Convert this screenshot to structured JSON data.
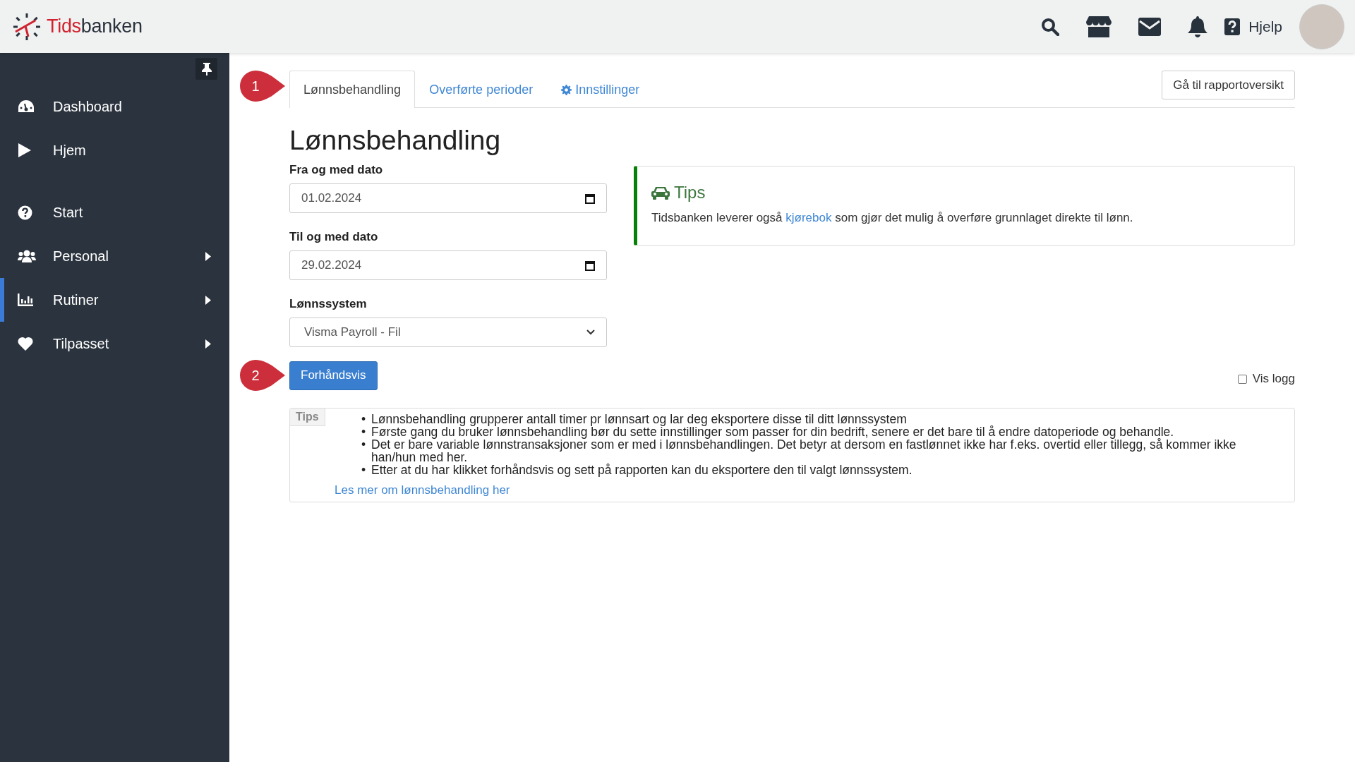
{
  "header": {
    "logo": {
      "part_1": "Tids",
      "part_2": "banken"
    },
    "help_label": "Hjelp"
  },
  "sidebar": {
    "sections": [
      [
        {
          "label": "Dashboard",
          "selected": false,
          "has_submenu": false
        },
        {
          "label": "Hjem",
          "selected": false,
          "has_submenu": false
        }
      ],
      [
        {
          "label": "Start",
          "selected": false,
          "has_submenu": false
        },
        {
          "label": "Personal",
          "selected": false,
          "has_submenu": true
        },
        {
          "label": "Rutiner",
          "selected": true,
          "has_submenu": true
        },
        {
          "label": "Tilpasset",
          "selected": false,
          "has_submenu": true
        }
      ]
    ]
  },
  "callouts": [
    {
      "number": "1"
    },
    {
      "number": "2"
    }
  ],
  "tabs": [
    {
      "label": "Lønnsbehandling",
      "selected": true,
      "has_icon": false
    },
    {
      "label": "Overførte perioder",
      "selected": false,
      "has_icon": false
    },
    {
      "label": "Innstillinger",
      "selected": false,
      "has_icon": true
    }
  ],
  "report_button": "Gå til rapportoversikt",
  "page_title": "Lønnsbehandling",
  "form": {
    "from_date": {
      "label": "Fra og med dato",
      "value": "01.02.2024"
    },
    "to_date": {
      "label": "Til og med dato",
      "value": "29.02.2024"
    },
    "payroll_system": {
      "label": "Lønnssystem",
      "value": "Visma Payroll - Fil"
    }
  },
  "tips_card": {
    "title": "Tips",
    "text_before": "Tidsbanken leverer også",
    "link": "kjørebok",
    "text_after": "som gjør det mulig å overføre grunnlaget direkte til lønn."
  },
  "preview_button": "Forhåndsvis",
  "show_log": {
    "label": "Vis logg",
    "checked": false
  },
  "help_box": {
    "tag": "Tips",
    "bullet": "•",
    "items": [
      "Lønnsbehandling grupperer antall timer pr lønnsart og lar deg eksportere disse til ditt lønnssystem",
      "Første gang du bruker lønnsbehandling bør du sette innstillinger som passer for din bedrift, senere er det bare til å endre datoperiode og behandle.",
      "Det er bare variable lønnstransaksjoner som er med i lønnsbehandlingen. Det betyr at dersom en fastlønnet ikke har f.eks. overtid eller tillegg, så kommer ikke han/hun med her.",
      "Etter at du har klikket forhåndsvis og sett på rapporten kan du eksportere den til valgt lønnssystem."
    ],
    "link": "Les mer om lønnsbehandling her"
  }
}
